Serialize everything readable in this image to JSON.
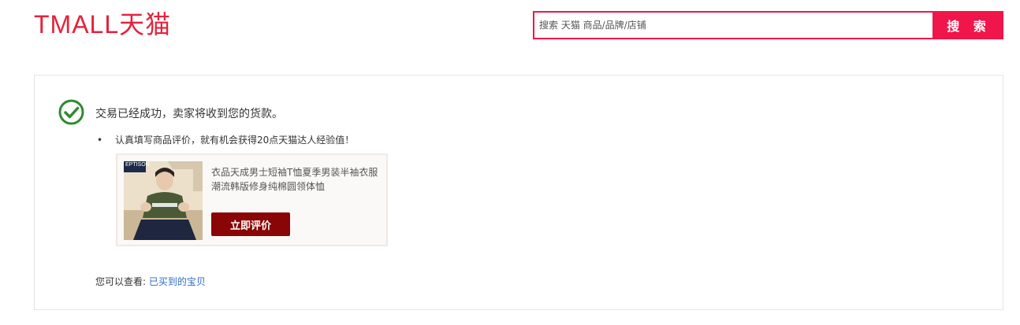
{
  "header": {
    "logo_text": "TMALL天猫",
    "brand_color": "#e4223c",
    "search": {
      "placeholder": "搜索 天猫 商品/品牌/店铺",
      "button_label": "搜 索",
      "accent_color": "#f0154a"
    }
  },
  "result": {
    "icon": "check-circle-icon",
    "message": "交易已经成功，卖家将收到您的货款。",
    "tip": "认真填写商品评价，就有机会获得20点天猫达人经验值！",
    "product": {
      "image_label": "EPTISON",
      "title": "衣品天成男士短袖T恤夏季男装半袖衣服潮流韩版修身纯棉圆领体恤",
      "review_button": "立即评价"
    },
    "view_more_label": "您可以查看:",
    "view_more_link": "已买到的宝贝"
  }
}
